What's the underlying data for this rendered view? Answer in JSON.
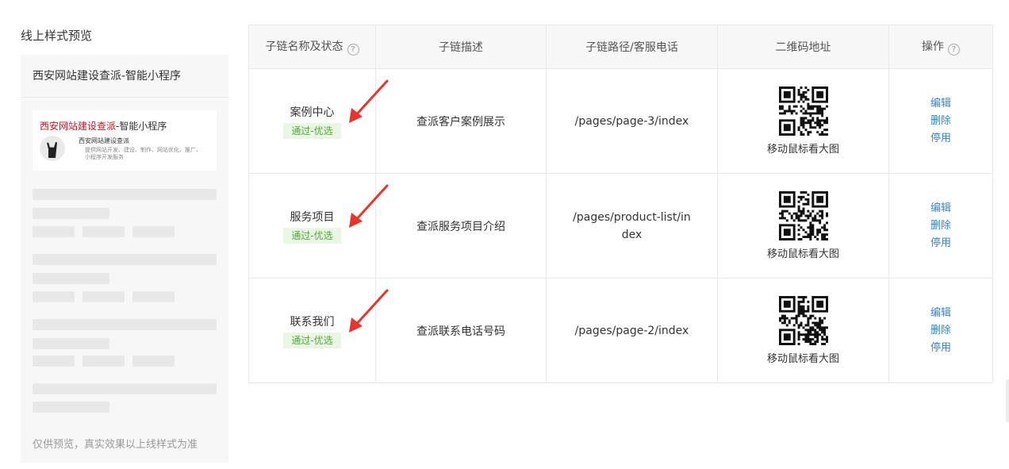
{
  "preview": {
    "title": "线上样式预览",
    "header": "西安网站建设查派-智能小程序",
    "card": {
      "title_brand": "西安网站建设查派",
      "title_rest": "-智能小程序",
      "name": "西安网站建设查派",
      "desc": "提供网站开发、建设、制作、网站优化、推广、小程序开发服务"
    },
    "footer": "仅供预览，真实效果以上线样式为准"
  },
  "table": {
    "headers": [
      "子链名称及状态",
      "子链描述",
      "子链路径/客服电话",
      "二维码地址",
      "操作"
    ],
    "help_glyph": "?",
    "rows": [
      {
        "name": "案例中心",
        "status": "通过-优选",
        "desc": "查派客户案例展示",
        "path": "/pages/page-3/index",
        "qr_tip": "移动鼠标看大图"
      },
      {
        "name": "服务项目",
        "status": "通过-优选",
        "desc": "查派服务项目介绍",
        "path": "/pages/product-list/index",
        "qr_tip": "移动鼠标看大图"
      },
      {
        "name": "联系我们",
        "status": "通过-优选",
        "desc": "查派联系电话号码",
        "path": "/pages/page-2/index",
        "qr_tip": "移动鼠标看大图"
      }
    ],
    "ops": {
      "edit": "编辑",
      "delete": "删除",
      "disable": "停用"
    }
  },
  "colors": {
    "link": "#3a83c9",
    "badge_text": "#52a83a",
    "badge_bg": "#e8f6e3",
    "annotation_arrow": "#e8342c",
    "brand_red": "#c8161e"
  },
  "icons": {
    "help": "question-circle-icon",
    "annotation": "red-arrow-icon",
    "qr": "qr-code-icon"
  }
}
